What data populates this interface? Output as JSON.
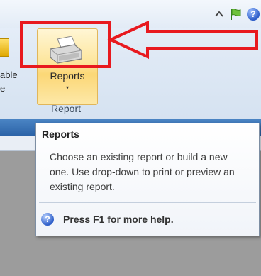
{
  "ribbon": {
    "left_partial_label_line1": "able",
    "left_partial_label_line2": "e",
    "reports_button_label": "Reports",
    "reports_dropdown_glyph": "▾",
    "group_label": "Report"
  },
  "top_icons": [
    {
      "name": "caret-up-icon"
    },
    {
      "name": "flag-icon"
    },
    {
      "name": "help-icon",
      "glyph": "?"
    }
  ],
  "tooltip": {
    "title": "Reports",
    "description": "Choose an existing report or build a new one. Use drop-down to print or preview an existing report.",
    "help_icon_glyph": "?",
    "help_text": "Press F1 for more help."
  },
  "colors": {
    "annotation": "#e8191f",
    "ribbon_band": "#2b62a6",
    "button_highlight": "#fbd776",
    "background": "#9c9c9c"
  }
}
